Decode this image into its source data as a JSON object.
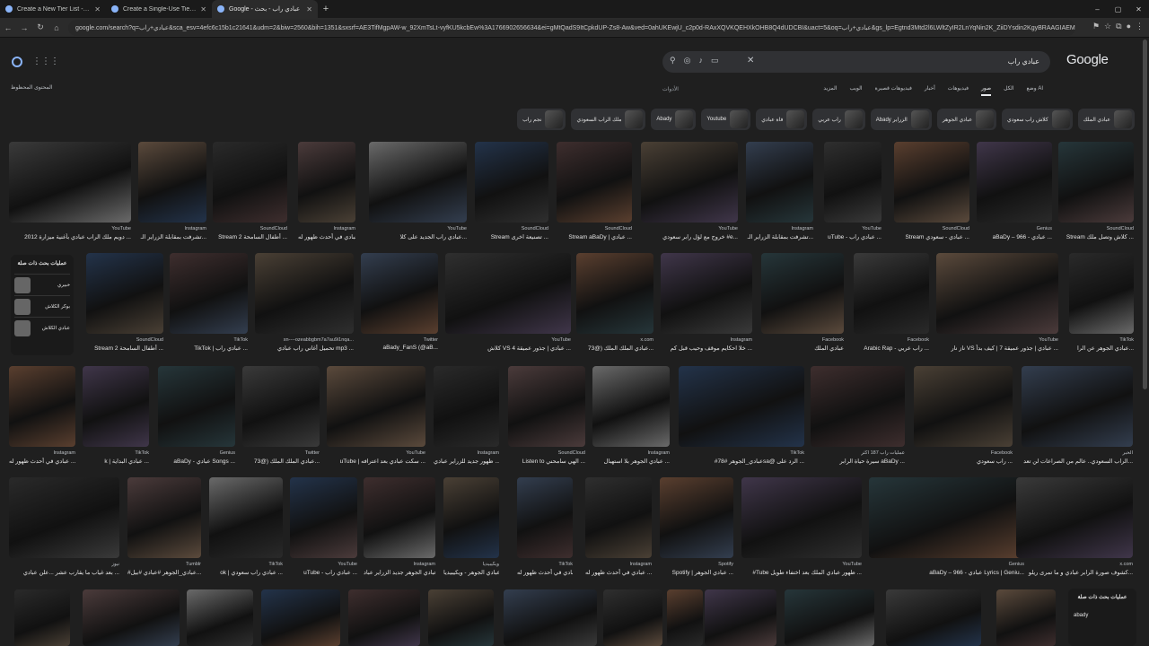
{
  "browser": {
    "tabs": [
      {
        "title": "Create a New Tier List - TierMaker",
        "active": false
      },
      {
        "title": "Create a Single-Use Tier List (FREE)",
        "active": false
      },
      {
        "title": "Google - عبادي راب - بحث",
        "active": true
      }
    ],
    "url": "google.com/search?q=عبادي+راب&sca_esv=4efc6c15b1c21641&udm=2&biw=2560&bih=1351&sxsrf=AE3TifMgpAW-w_92XmTsLt-vyfKU5kcbEw%3A1766902656634&ei=gMtQadS9ItCpkdUP-Zs8-Aw&ved=0ahUKEwjU_c2p0d-RAxXQVKQEHXkOHB8Q4dUDCBI&uact=5&oq=عبادي+راب&gs_lp=Egtnd3Mtd2l6LWltZyIR2LnYqNin2K_ZiiDYsdin2KgyBRAAGIAEMgUQABiA"
  },
  "search": {
    "query": "عبادي راب",
    "logo": "Google"
  },
  "filters": [
    "وضع AI",
    "الكل",
    "صور",
    "فيديوهات",
    "أخبار",
    "فيديوهات قصيرة",
    "الويب",
    "المزيد"
  ],
  "filters_active": "صور",
  "tools_label": "الأدوات",
  "safe_label": "المحتوى المحظوظ",
  "chips": [
    "عبادي الملك",
    "كلاش راب سعودي",
    "عبادي الجوهر",
    "Abady الزراير",
    "راب عربي",
    "فاة عبادي",
    "Youtube",
    "Abady",
    "ملك الراب السعودي",
    "نجم راب"
  ],
  "related": {
    "title": "عمليات بحث ذات صلة",
    "items": [
      "خبيري",
      "بوكر الكلاش",
      "عبادي الكلاش"
    ]
  },
  "related2": {
    "title": "عمليات بحث ذات صلة",
    "item": "abady"
  },
  "rows": [
    [
      {
        "src": "YouTube",
        "cap": "دويم ملك الراب عبادي بأغنية ميزارة 2012 ..."
      },
      {
        "src": "Instagram",
        "cap": "تشرفت بمقابلة الزراير الـ..."
      },
      {
        "src": "SoundCloud",
        "cap": "Stream أطفال السامحة 2 ..."
      },
      {
        "src": "Instagram",
        "cap": "عبادي في أحدث ظهور له ..."
      },
      {
        "src": "YouTube",
        "cap": "عبادي راب الجديد على كلا..."
      },
      {
        "src": "SoundCloud",
        "cap": "Stream تصنيعة اخرى ..."
      },
      {
        "src": "SoundCloud",
        "cap": "Stream aBaDy | عبادي ..."
      },
      {
        "src": "YouTube",
        "cap": "خروج مع لؤل رابر سعودي #e..."
      },
      {
        "src": "Instagram",
        "cap": "تشرفت بمقابلة الزراير الـ..."
      },
      {
        "src": "YouTube",
        "cap": "uTube - عبادي راب ..."
      },
      {
        "src": "SoundCloud",
        "cap": "Stream عبادي - سعودي ..."
      },
      {
        "src": "Genius",
        "cap": "aBaDy – 966 - عبادي ..."
      },
      {
        "src": "SoundCloud",
        "cap": "Stream كلاش وتصل ملك ..."
      }
    ],
    [
      {
        "src": "SoundCloud",
        "cap": "Stream أطفال السامحة 2 ..."
      },
      {
        "src": "TikTok",
        "cap": "TikTok | عبادي راب ..."
      },
      {
        "src": "xn----ozeabbgbm7a7au9i1nqa...",
        "cap": "تحميل أغاني راب عبادي mp3 ..."
      },
      {
        "src": "Twitter",
        "cap": "aBady_FanS (@aB..."
      },
      {
        "src": "YouTube",
        "cap": "كلاش VS عبادي | جذور عميقة 4 ..."
      },
      {
        "src": "x.com",
        "cap": "عبادي الملك الملك (@73..."
      },
      {
        "src": "Instagram",
        "cap": "خلا احكايم موقف وحيب قبل كم ..."
      },
      {
        "src": "Facebook",
        "cap": "عبادي الملك"
      },
      {
        "src": "Facebook",
        "cap": "Arabic Rap - راب عربي ..."
      },
      {
        "src": "YouTube",
        "cap": "ناز نار VS عبادي | جذور عميقة 7 | كيف بدأ ..."
      },
      {
        "src": "TikTok",
        "cap": "عبادي الجوهر عن الرا..."
      }
    ],
    [
      {
        "src": "Instagram",
        "cap": "عبادي في أحدث ظهور له ..."
      },
      {
        "src": "TikTok",
        "cap": "k | عبادي البداية ..."
      },
      {
        "src": "Genius",
        "cap": "aBaDy - عبادي Songs ..."
      },
      {
        "src": "Twitter",
        "cap": "عبادي الملك الملك (@73..."
      },
      {
        "src": "YouTube",
        "cap": "uTube | سكت عبادي بعد اعترافه ..."
      },
      {
        "src": "Instagram",
        "cap": "ظهور جديد للزراير عبادي ..."
      },
      {
        "src": "SoundCloud",
        "cap": "Listen to الهي سامحني ..."
      },
      {
        "src": "Instagram",
        "cap": "عبادي الجوهر بلا استهبال ..."
      },
      {
        "src": "TikTok",
        "cap": "#عبادي_الجوهر #78sa@ الرد على ..."
      },
      {
        "src": "عمليات راب 187 أكثر",
        "cap": "سيرة حياة الرابر aBaDy ..."
      },
      {
        "src": "Facebook",
        "cap": "راب سعودي ..."
      },
      {
        "src": "الخبر",
        "cap": "الراب السعودي.. عالم من الصراعات لن تعد..."
      }
    ],
    [
      {
        "src": "نيوز",
        "cap": "بعد غياب ما يقارب عشر ...علن عبادي ..."
      },
      {
        "src": "Tumblr",
        "cap": "#عبادي_الجوهر #عبادي #بيل..."
      },
      {
        "src": "TikTok",
        "cap": "ok | عبادي راب سعودي ..."
      },
      {
        "src": "YouTube",
        "cap": "uTube - عبادي راب ..."
      },
      {
        "src": "Instagram",
        "cap": "عبادي الجوهر جديد الزراير عباد..."
      },
      {
        "src": "ويكيبيديا",
        "cap": "عبادي الجوهر - ويكيبيديا ..."
      },
      {
        "src": "TikTok",
        "cap": "عبادي في أحدث ظهور له ..."
      },
      {
        "src": "Instagram",
        "cap": "عبادي في أحدث ظهور له ..."
      },
      {
        "src": "Spotify",
        "cap": "Spotify | عبادي الجوهر ..."
      },
      {
        "src": "YouTube",
        "cap": "#Tube ظهور عبادي الملك بعد اختفاء طويل ..."
      },
      {
        "src": "Genius",
        "cap": "aBaDy – 966 - عبادي Lyrics | Geniu..."
      },
      {
        "src": "x.com",
        "cap": "كشوف صورة الرابر عبادي و ما تمرى ريلو..."
      }
    ]
  ],
  "colors": {
    "bg": "#1f1f1f",
    "accent": "#8ab4f8",
    "text": "#e3e3e3"
  }
}
